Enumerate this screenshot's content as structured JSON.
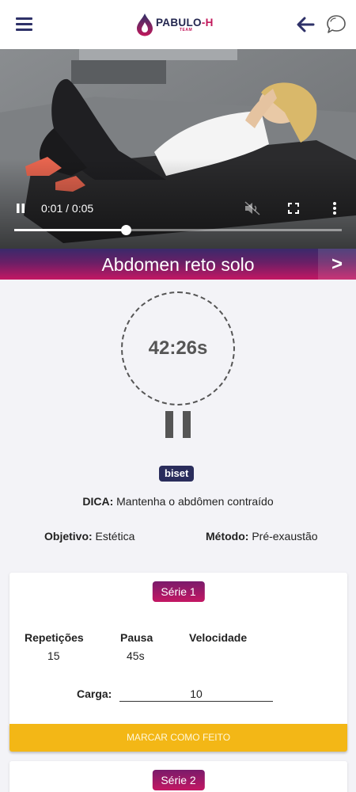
{
  "header": {
    "logo_text_main": "PABULO",
    "logo_text_suffix": "-H",
    "logo_text_sub": "TEAM"
  },
  "video": {
    "time_display": "0:01 / 0:05",
    "progress_fraction": 0.34
  },
  "exercise": {
    "title": "Abdomen reto solo",
    "next_label": ">"
  },
  "timer": {
    "value": "42:26s"
  },
  "info": {
    "badge": "biset",
    "dica_label": "DICA:",
    "dica_text": " Mantenha o abdômen contraído",
    "objetivo_label": "Objetivo:",
    "objetivo_value": " Estética",
    "metodo_label": "Método:",
    "metodo_value": " Pré-exaustão"
  },
  "series": [
    {
      "label": "Série 1",
      "headers": {
        "repeticoes": "Repetições",
        "pausa": "Pausa",
        "velocidade": "Velocidade"
      },
      "values": {
        "repeticoes": "15",
        "pausa": "45s",
        "velocidade": ""
      },
      "carga_label": "Carga:",
      "carga_value": "10",
      "done_label": "MARCAR COMO FEITO"
    },
    {
      "label": "Série 2"
    }
  ],
  "colors": {
    "navy": "#2e3168",
    "accent": "#c41763",
    "button_yellow": "#f3b716"
  }
}
